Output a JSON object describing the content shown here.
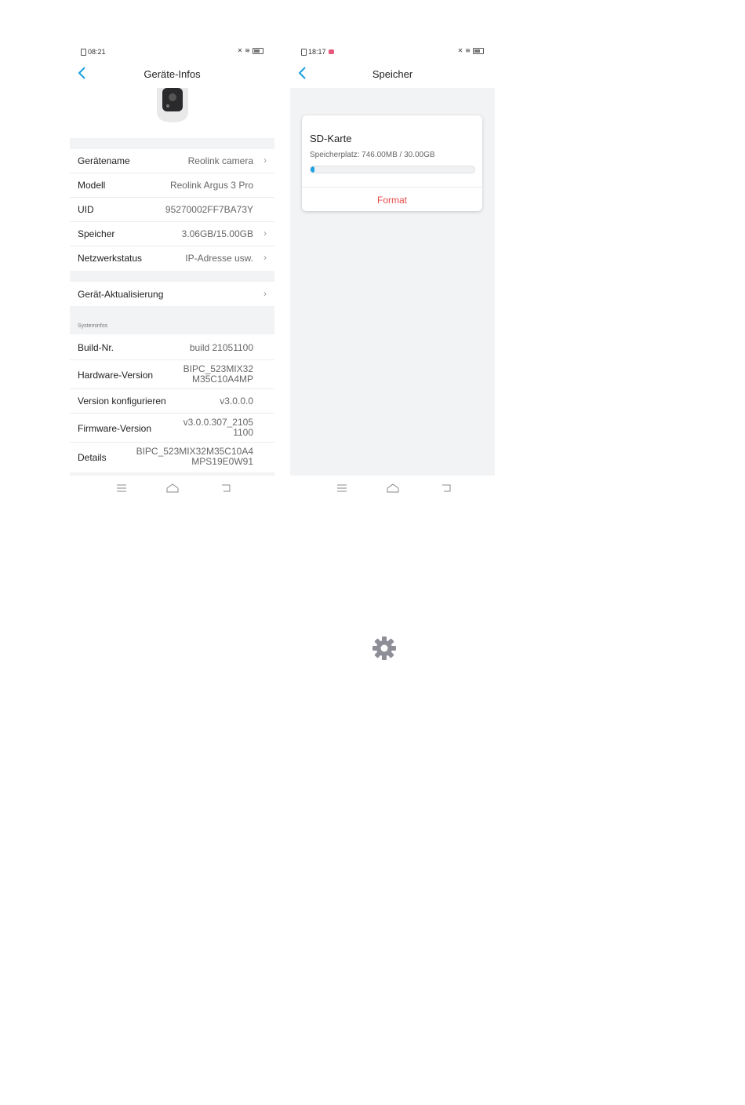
{
  "left_screen": {
    "status_time": "08:21",
    "title": "Geräte-Infos",
    "rows": [
      {
        "label": "Gerätename",
        "value": "Reolink camera"
      },
      {
        "label": "Modell",
        "value": "Reolink Argus 3 Pro"
      },
      {
        "label": "UID",
        "value": "95270002FF7BA73Y"
      },
      {
        "label": "Speicher",
        "value": "3.06GB/15.00GB"
      },
      {
        "label": "Netzwerkstatus",
        "value": "IP-Adresse usw."
      }
    ],
    "update_label": "Gerät-Aktualisierung",
    "section_label": "Systeminfos",
    "sys_rows": [
      {
        "label": "Build-Nr.",
        "value": "build 21051100"
      },
      {
        "label": "Hardware-Version",
        "value": "BIPC_523MIX32",
        "value2": "M35C10A4MP"
      },
      {
        "label": "Version konfigurieren",
        "value": "v3.0.0.0"
      },
      {
        "label": "Firmware-Version",
        "value": "v3.0.0.307_2105",
        "value2": "1100"
      },
      {
        "label": "Details",
        "value": "BIPC_523MIX32M35C10A4",
        "value2": "MPS19E0W91"
      }
    ]
  },
  "right_screen": {
    "status_time": "18:17",
    "title": "Speicher",
    "card_title": "SD-Karte",
    "usage_text": "Speicherplatz: 746.00MB / 30.00GB",
    "usage_fraction": 0.0243,
    "format_label": "Format"
  },
  "colors": {
    "accent": "#1aa1e0",
    "danger": "#e84b4b",
    "background_gray": "#f2f3f5",
    "gear": "#8e8f96"
  }
}
